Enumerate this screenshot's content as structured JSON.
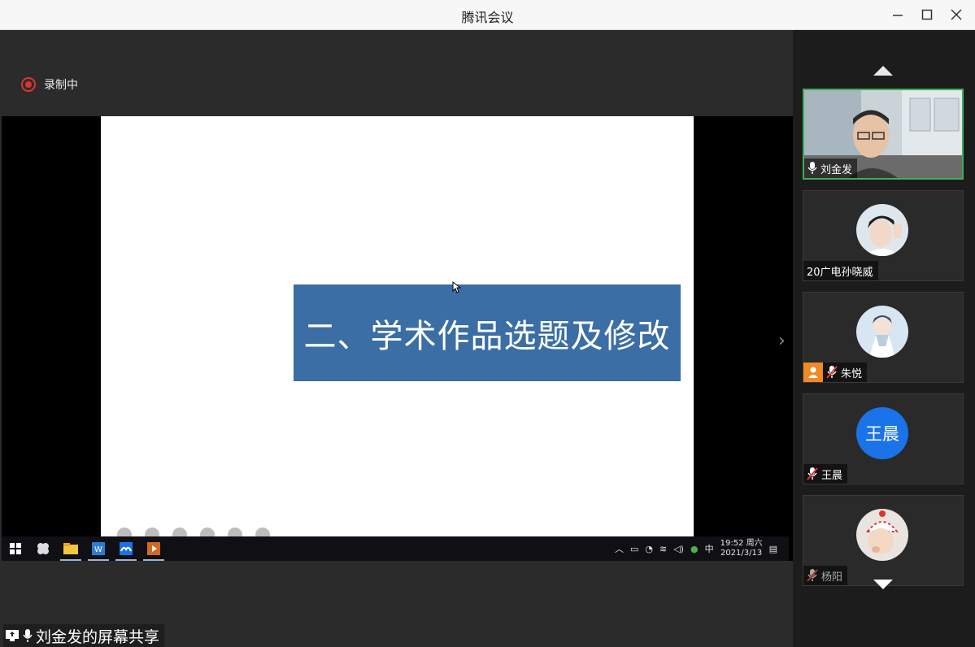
{
  "window": {
    "title": "腾讯会议"
  },
  "recording": {
    "label": "录制中"
  },
  "slide": {
    "banner_text": "二、学术作品选题及修改"
  },
  "taskbar": {
    "ime": "中",
    "time": "19:52 周六",
    "date": "2021/3/13"
  },
  "share": {
    "label": "刘金发的屏幕共享"
  },
  "participants": [
    {
      "name": "刘金发",
      "mic": "on",
      "video": true,
      "speaking": true
    },
    {
      "name": "20广电孙晓威",
      "mic": "none",
      "video": false
    },
    {
      "name": "朱悦",
      "mic": "muted",
      "video": false,
      "host": true
    },
    {
      "name": "王晨",
      "mic": "muted",
      "video": false,
      "avatar_text": "王晨"
    },
    {
      "name": "杨阳",
      "mic": "muted",
      "video": false
    }
  ],
  "colors": {
    "accent_blue": "#1a73e8",
    "banner_blue": "#3b6ea4",
    "record_red": "#dd3333",
    "speaking_green": "#3fae5a",
    "host_orange": "#f08a24"
  }
}
